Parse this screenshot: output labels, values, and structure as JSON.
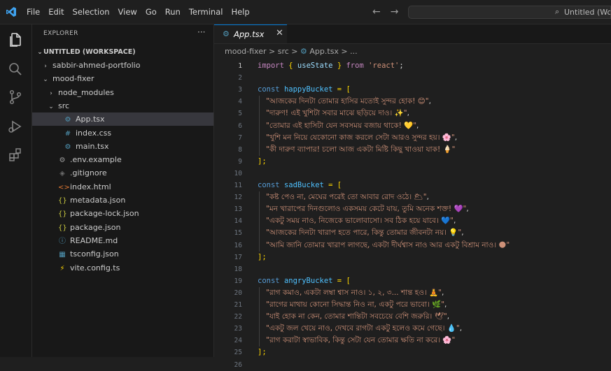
{
  "menu": [
    "File",
    "Edit",
    "Selection",
    "View",
    "Go",
    "Run",
    "Terminal",
    "Help"
  ],
  "command_center": {
    "text": "Untitled (Wor"
  },
  "colors": {
    "accent": "#0078d4",
    "string": "#ce9178",
    "keyword": "#569cd6",
    "import_keyword": "#c586c0",
    "variable": "#4fc1ff",
    "bracket": "#ffd700"
  },
  "activity_icons": [
    "files-icon",
    "search-icon",
    "source-control-icon",
    "run-debug-icon",
    "extensions-icon"
  ],
  "explorer": {
    "title": "EXPLORER",
    "more": "···",
    "workspace": "UNTITLED (WORKSPACE)",
    "items": [
      {
        "label": "sabbir-ahmed-portfolio",
        "depth": 1,
        "chevron": "›",
        "icon": ""
      },
      {
        "label": "mood-fixer",
        "depth": 1,
        "chevron": "⌄",
        "icon": ""
      },
      {
        "label": "node_modules",
        "depth": 2,
        "chevron": "›",
        "icon": ""
      },
      {
        "label": "src",
        "depth": 2,
        "chevron": "⌄",
        "icon": ""
      },
      {
        "label": "App.tsx",
        "depth": 3,
        "chevron": "",
        "icon": "⚙",
        "icon_color": "#519aba",
        "selected": true
      },
      {
        "label": "index.css",
        "depth": 3,
        "chevron": "",
        "icon": "#",
        "icon_color": "#519aba"
      },
      {
        "label": "main.tsx",
        "depth": 3,
        "chevron": "",
        "icon": "⚙",
        "icon_color": "#519aba"
      },
      {
        "label": ".env.example",
        "depth": 2,
        "chevron": "",
        "icon": "⚙",
        "icon_color": "#9d9d9d"
      },
      {
        "label": ".gitignore",
        "depth": 2,
        "chevron": "",
        "icon": "◈",
        "icon_color": "#6d6d6d"
      },
      {
        "label": "index.html",
        "depth": 2,
        "chevron": "",
        "icon": "<>",
        "icon_color": "#e37933"
      },
      {
        "label": "metadata.json",
        "depth": 2,
        "chevron": "",
        "icon": "{}",
        "icon_color": "#cbcb41"
      },
      {
        "label": "package-lock.json",
        "depth": 2,
        "chevron": "",
        "icon": "{}",
        "icon_color": "#cbcb41"
      },
      {
        "label": "package.json",
        "depth": 2,
        "chevron": "",
        "icon": "{}",
        "icon_color": "#cbcb41"
      },
      {
        "label": "README.md",
        "depth": 2,
        "chevron": "",
        "icon": "ⓘ",
        "icon_color": "#519aba"
      },
      {
        "label": "tsconfig.json",
        "depth": 2,
        "chevron": "",
        "icon": "▦",
        "icon_color": "#519aba"
      },
      {
        "label": "vite.config.ts",
        "depth": 2,
        "chevron": "",
        "icon": "⚡",
        "icon_color": "#ffd700"
      }
    ]
  },
  "tab": {
    "label": "App.tsx",
    "close": "✕"
  },
  "breadcrumb": {
    "parts": [
      "mood-fixer",
      "src",
      "App.tsx",
      "..."
    ],
    "sep": " > "
  },
  "code": {
    "import_line": {
      "kw": "import",
      "open": "{",
      "name": "useState",
      "close": "}",
      "from": "from",
      "module": "'react'",
      "semi": ";"
    },
    "buckets": [
      {
        "name": "happyBucket",
        "strings": [
          "\"আজকের দিনটা তোমার হাসির মতোই সুন্দর হোক! 😊\"",
          "\"দারুণ! এই খুশিটা সবার মাঝে ছড়িয়ে দাও। ✨\"",
          "\"তোমার এই হাসিটা যেন সবসময় বজায় থাকে! 💛\"",
          "\"খুশি মন নিয়ে যেকোনো কাজ করলে সেটা আরও সুন্দর হয়। 🌸\"",
          "\"কী দারুণ ব্যাপার! চলো আজ একটা মিষ্টি কিছু খাওয়া যাক! 🍦\""
        ]
      },
      {
        "name": "sadBucket",
        "strings": [
          "\"কষ্ট পেও না, মেঘের পরেই তো আবার রোদ ওঠে। 🌥\"",
          "\"মন খারাপের দিনগুলোও একসময় কেটে যায়, তুমি অনেক শক্ত! 💜\"",
          "\"একটু সময় নাও, নিজেকে ভালোবাসো। সব ঠিক হয়ে যাবে। 💙\"",
          "\"আজকের দিনটা খারাপ হতে পারে, কিন্তু তোমার জীবনটা নয়। 💡\"",
          "\"আমি জানি তোমার খারাপ লাগছে, একটা দীর্ঘশ্বাস নাও আর একটু বিশ্রাম নাও। 🌑\""
        ]
      },
      {
        "name": "angryBucket",
        "strings": [
          "\"রাগ কমাও, একটা লম্বা শ্বাস নাও। ১, ২, ৩... শান্ত হও। 🧘\"",
          "\"রাগের মাথায় কোনো সিদ্ধান্ত নিও না, একটু পরে ভাবো। 🌿\"",
          "\"যাই হোক না কেন, তোমার শান্তিটা সবচেয়ে বেশি জরুরি। 🕊\"",
          "\"একটু জল খেয়ে নাও, দেখবে রাগটা একটু হলেও কমে গেছে। 💧\"",
          "\"রাগ করাটা স্বাভাবিক, কিন্তু সেটা যেন তোমার ক্ষতি না করে। 🌸\""
        ]
      }
    ],
    "kw_const": "const",
    "eq_bracket": " = [",
    "close_bracket": "];",
    "line_numbers": [
      "1",
      "2",
      "3",
      "4",
      "5",
      "6",
      "7",
      "8",
      "9",
      "10",
      "11",
      "12",
      "13",
      "14",
      "15",
      "16",
      "17",
      "18",
      "19",
      "20",
      "21",
      "22",
      "23",
      "24",
      "25",
      "26"
    ]
  }
}
